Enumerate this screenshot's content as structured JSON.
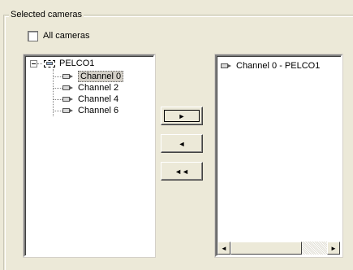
{
  "group": {
    "title": "Selected cameras"
  },
  "all_cameras": {
    "label": "All cameras",
    "checked": false
  },
  "tree": {
    "root_label": "PELCO1",
    "root_icon": "dvr-icon",
    "channels": [
      {
        "label": "Channel 0",
        "icon": "camera-icon",
        "selected": true
      },
      {
        "label": "Channel 2",
        "icon": "camera-icon",
        "selected": false
      },
      {
        "label": "Channel 4",
        "icon": "camera-icon",
        "selected": false
      },
      {
        "label": "Channel 6",
        "icon": "camera-icon",
        "selected": false
      }
    ]
  },
  "buttons": {
    "add": "►",
    "remove": "◄",
    "remove_all": "◄◄"
  },
  "selected_list": [
    {
      "label": "Channel 0 - PELCO1",
      "icon": "camera-icon"
    }
  ],
  "scrollbar": {
    "left_arrow": "◄",
    "right_arrow": "►"
  }
}
